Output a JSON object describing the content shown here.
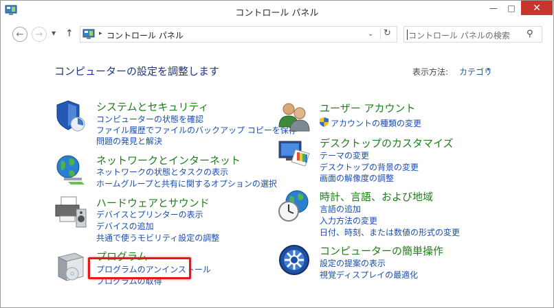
{
  "window": {
    "title": "コントロール パネル",
    "minimize": "—",
    "maximize": "□",
    "close": "✕"
  },
  "nav": {
    "back": "←",
    "forward": "→",
    "recent": "▼",
    "up": "↑"
  },
  "address": {
    "separator": "▸",
    "path": "コントロール パネル",
    "dropdown": "⌄",
    "refresh": "↻"
  },
  "search": {
    "placeholder": "コントロール パネルの検索",
    "icon": "⚲"
  },
  "main": {
    "heading": "コンピューターの設定を調整します",
    "view_by_label": "表示方法:",
    "view_by_value": "カテゴリ",
    "view_by_caret": "▾"
  },
  "categories": [
    {
      "title": "システムとセキュリティ",
      "links": [
        "コンピューターの状態を確認",
        "ファイル履歴でファイルのバックアップ コピーを保存",
        "問題の発見と解決"
      ]
    },
    {
      "title": "ネットワークとインターネット",
      "links": [
        "ネットワークの状態とタスクの表示",
        "ホームグループと共有に関するオプションの選択"
      ]
    },
    {
      "title": "ハードウェアとサウンド",
      "links": [
        "デバイスとプリンターの表示",
        "デバイスの追加",
        "共通で使うモビリティ設定の調整"
      ]
    },
    {
      "title": "プログラム",
      "links": [
        "プログラムのアンインストール",
        "プログラムの取得"
      ]
    },
    {
      "title": "ユーザー アカウント",
      "links": [
        "アカウントの種類の変更"
      ]
    },
    {
      "title": "デスクトップのカスタマイズ",
      "links": [
        "テーマの変更",
        "デスクトップの背景の変更",
        "画面の解像度の調整"
      ]
    },
    {
      "title": "時計、言語、および地域",
      "links": [
        "言語の追加",
        "入力方法の変更",
        "日付、時刻、または数値の形式の変更"
      ]
    },
    {
      "title": "コンピューターの簡単操作",
      "links": [
        "設定の提案の表示",
        "視覚ディスプレイの最適化"
      ]
    }
  ],
  "colors": {
    "category_title": "#1f7d19",
    "link": "#1a4eaf",
    "heading": "#1e3287",
    "highlight": "#e6161b",
    "close_button": "#c7362e"
  }
}
